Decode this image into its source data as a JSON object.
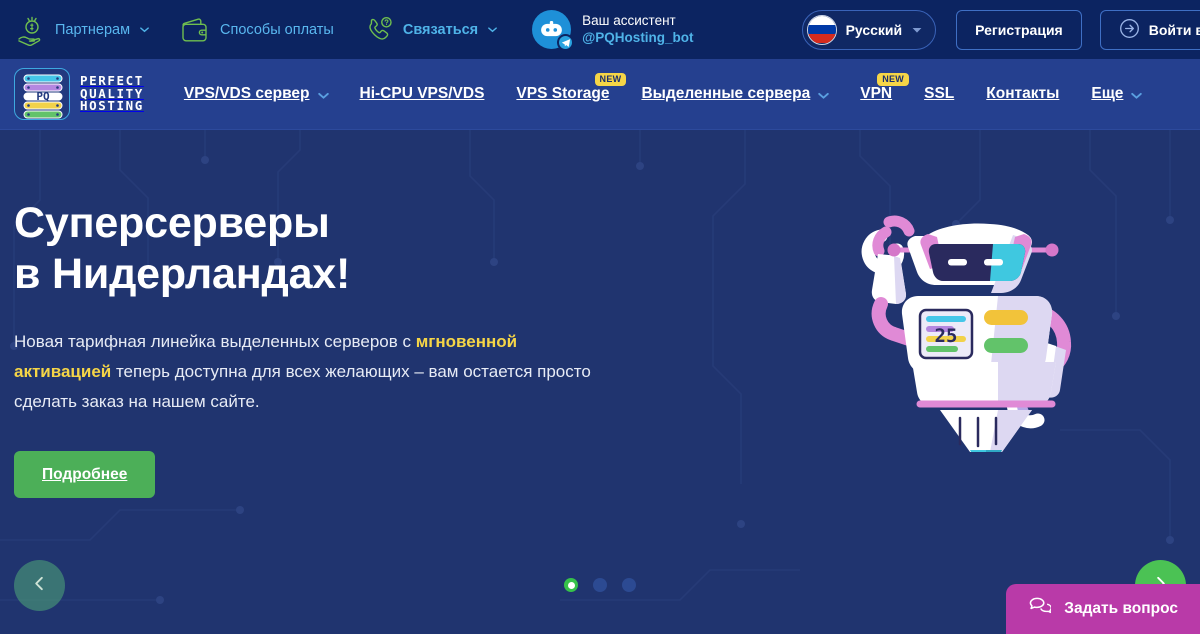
{
  "topbar": {
    "partners": {
      "label": "Партнерам",
      "icon": "hand-coin-icon",
      "caret": "chevron-down-icon"
    },
    "payment": {
      "label": "Способы оплаты",
      "icon": "wallet-icon"
    },
    "contact": {
      "label": "Связаться",
      "icon": "phone-question-icon",
      "caret": "chevron-down-icon"
    },
    "assistant": {
      "line1": "Ваш ассистент",
      "line2": "@PQHosting_bot",
      "icon": "robot-avatar-icon",
      "badge": "telegram-badge-icon"
    },
    "language": {
      "label": "Русский",
      "flag": "russia-flag-icon",
      "caret": "chevron-down-icon"
    },
    "register": {
      "label": "Регистрация"
    },
    "login": {
      "label": "Войти в биллинг",
      "icon": "login-arrow-icon"
    }
  },
  "logo": {
    "line1": "PERFECT",
    "line2": "QUALITY",
    "line3": "HOSTING",
    "mark": "server-rack-icon"
  },
  "nav": {
    "items": [
      {
        "label": "VPS/VDS сервер",
        "caret": true,
        "badge": null
      },
      {
        "label": "Hi-CPU VPS/VDS",
        "caret": false,
        "badge": null
      },
      {
        "label": "VPS Storage",
        "caret": false,
        "badge": "NEW"
      },
      {
        "label": "Выделенные сервера",
        "caret": true,
        "badge": null
      },
      {
        "label": "VPN",
        "caret": false,
        "badge": "NEW"
      },
      {
        "label": "SSL",
        "caret": false,
        "badge": null
      },
      {
        "label": "Контакты",
        "caret": false,
        "badge": null
      },
      {
        "label": "Еще",
        "caret": true,
        "badge": null
      }
    ]
  },
  "hero": {
    "title_line1": "Суперсерверы",
    "title_line2": "в Нидерландах!",
    "paragraph_part1": "Новая тарифная линейка выделенных серверов с ",
    "paragraph_highlight": "мгновенной активацией",
    "paragraph_part2": " теперь доступна для всех желающих – вам остается просто сделать заказ на нашем сайте.",
    "cta_label": "Подробнее",
    "mascot": "robot-mascot-illustration"
  },
  "carousel": {
    "prev_icon": "chevron-left-icon",
    "next_icon": "chevron-right-icon",
    "slides": 3,
    "active_index": 0
  },
  "chat_widget": {
    "label": "Задать вопрос",
    "icon": "chat-bubbles-icon"
  },
  "colors": {
    "topbar_bg": "#0c2461",
    "navbar_bg": "#25408f",
    "hero_bg": "#20346f",
    "accent_green": "#4caf58",
    "accent_yellow": "#f5d547",
    "accent_magenta": "#b93aa8",
    "link_blue": "#4fb3e8",
    "icon_green": "#6fbf4f"
  }
}
